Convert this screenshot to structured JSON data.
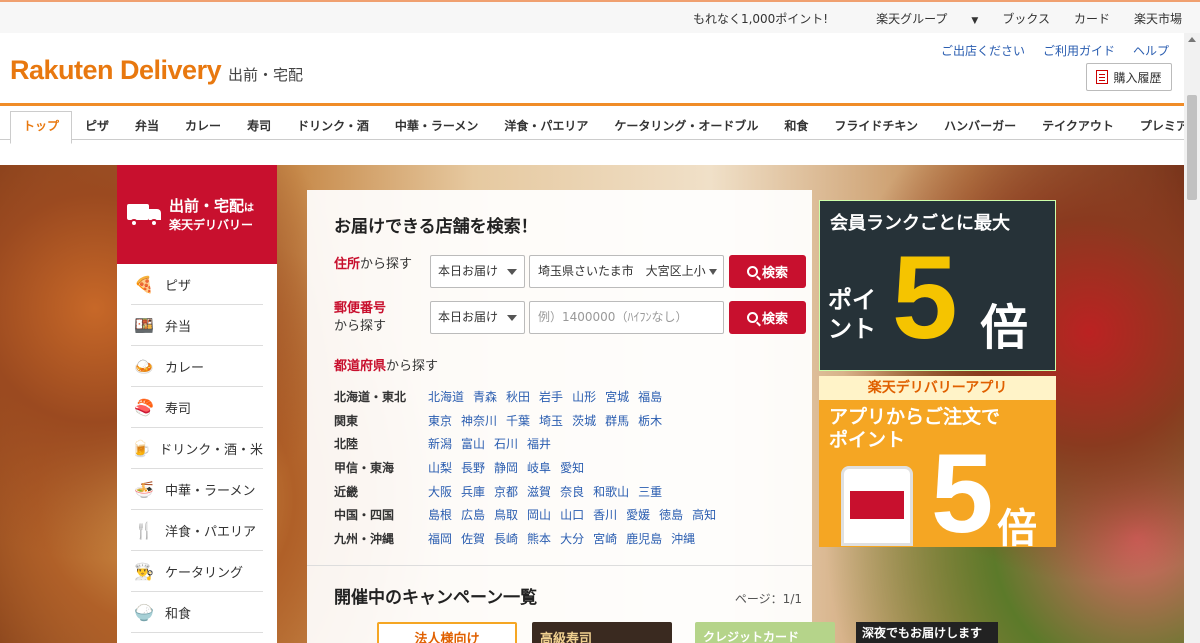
{
  "util_bar": {
    "links": [
      "もれなく1,000ポイント!",
      "楽天グループ",
      "ブックス",
      "カード",
      "楽天市場"
    ]
  },
  "header": {
    "logo": "Rakuten Delivery",
    "logo_sub": "出前・宅配",
    "links": [
      "ご出店ください",
      "ご利用ガイド",
      "ヘルプ"
    ],
    "history_button": "購入履歴"
  },
  "category_tabs": [
    "トップ",
    "ピザ",
    "弁当",
    "カレー",
    "寿司",
    "ドリンク・酒",
    "中華・ラーメン",
    "洋食・パエリア",
    "ケータリング・オードブル",
    "和食",
    "フライドチキン",
    "ハンバーガー",
    "テイクアウト",
    "プレミアム"
  ],
  "sidebar": {
    "head_line1": "出前・宅配",
    "head_line1_suffix": "は",
    "head_line2": "楽天デリバリー",
    "items": [
      {
        "label": "ピザ",
        "icon": "🍕"
      },
      {
        "label": "弁当",
        "icon": "🍱"
      },
      {
        "label": "カレー",
        "icon": "🍛"
      },
      {
        "label": "寿司",
        "icon": "🍣"
      },
      {
        "label": "ドリンク・酒・米",
        "icon": "🍺"
      },
      {
        "label": "中華・ラーメン",
        "icon": "🍜"
      },
      {
        "label": "洋食・パエリア",
        "icon": "🍴"
      },
      {
        "label": "ケータリング",
        "icon": "👨‍🍳"
      },
      {
        "label": "和食",
        "icon": "🍚"
      }
    ]
  },
  "search": {
    "title": "お届けできる店舗を検索！",
    "address_label_main": "住所",
    "address_label_rest": "から探す",
    "postal_label_main": "郵便番号",
    "postal_label_rest": "から探す",
    "delivery_select": "本日お届け",
    "address_value": "埼玉県さいたま市　大宮区上小",
    "postal_placeholder": "例）1400000（ﾊｲﾌﾝなし）",
    "search_button": "検索",
    "pref_label_main": "都道府県",
    "pref_label_rest": "から探す"
  },
  "regions": [
    {
      "name": "北海道・東北",
      "prefs": [
        "北海道",
        "青森",
        "秋田",
        "岩手",
        "山形",
        "宮城",
        "福島"
      ]
    },
    {
      "name": "関東",
      "prefs": [
        "東京",
        "神奈川",
        "千葉",
        "埼玉",
        "茨城",
        "群馬",
        "栃木"
      ]
    },
    {
      "name": "北陸",
      "prefs": [
        "新潟",
        "富山",
        "石川",
        "福井"
      ]
    },
    {
      "name": "甲信・東海",
      "prefs": [
        "山梨",
        "長野",
        "静岡",
        "岐阜",
        "愛知"
      ]
    },
    {
      "name": "近畿",
      "prefs": [
        "大阪",
        "兵庫",
        "京都",
        "滋賀",
        "奈良",
        "和歌山",
        "三重"
      ]
    },
    {
      "name": "中国・四国",
      "prefs": [
        "島根",
        "広島",
        "鳥取",
        "岡山",
        "山口",
        "香川",
        "愛媛",
        "徳島",
        "高知"
      ]
    },
    {
      "name": "九州・沖縄",
      "prefs": [
        "福岡",
        "佐賀",
        "長崎",
        "熊本",
        "大分",
        "宮崎",
        "鹿児島",
        "沖縄"
      ]
    }
  ],
  "campaign": {
    "title": "開催中のキャンペーン一覧",
    "page_count": "ページ：1/1",
    "thumbs": [
      "法人様向け",
      "高級寿司",
      "クレジットカード",
      "深夜でもお届けします"
    ]
  },
  "banner_rank": {
    "line1": "会員ランクごとに最大",
    "point": "ポイント",
    "number": "5",
    "suffix": "倍"
  },
  "banner_app": {
    "header": "楽天デリバリーアプリ",
    "line1": "アプリからご注文で",
    "line2": "ポイント",
    "number": "5",
    "suffix": "倍"
  },
  "colors": {
    "brand_orange": "#e8780f",
    "brand_red": "#c8102e",
    "link_blue": "#2a5db0"
  }
}
